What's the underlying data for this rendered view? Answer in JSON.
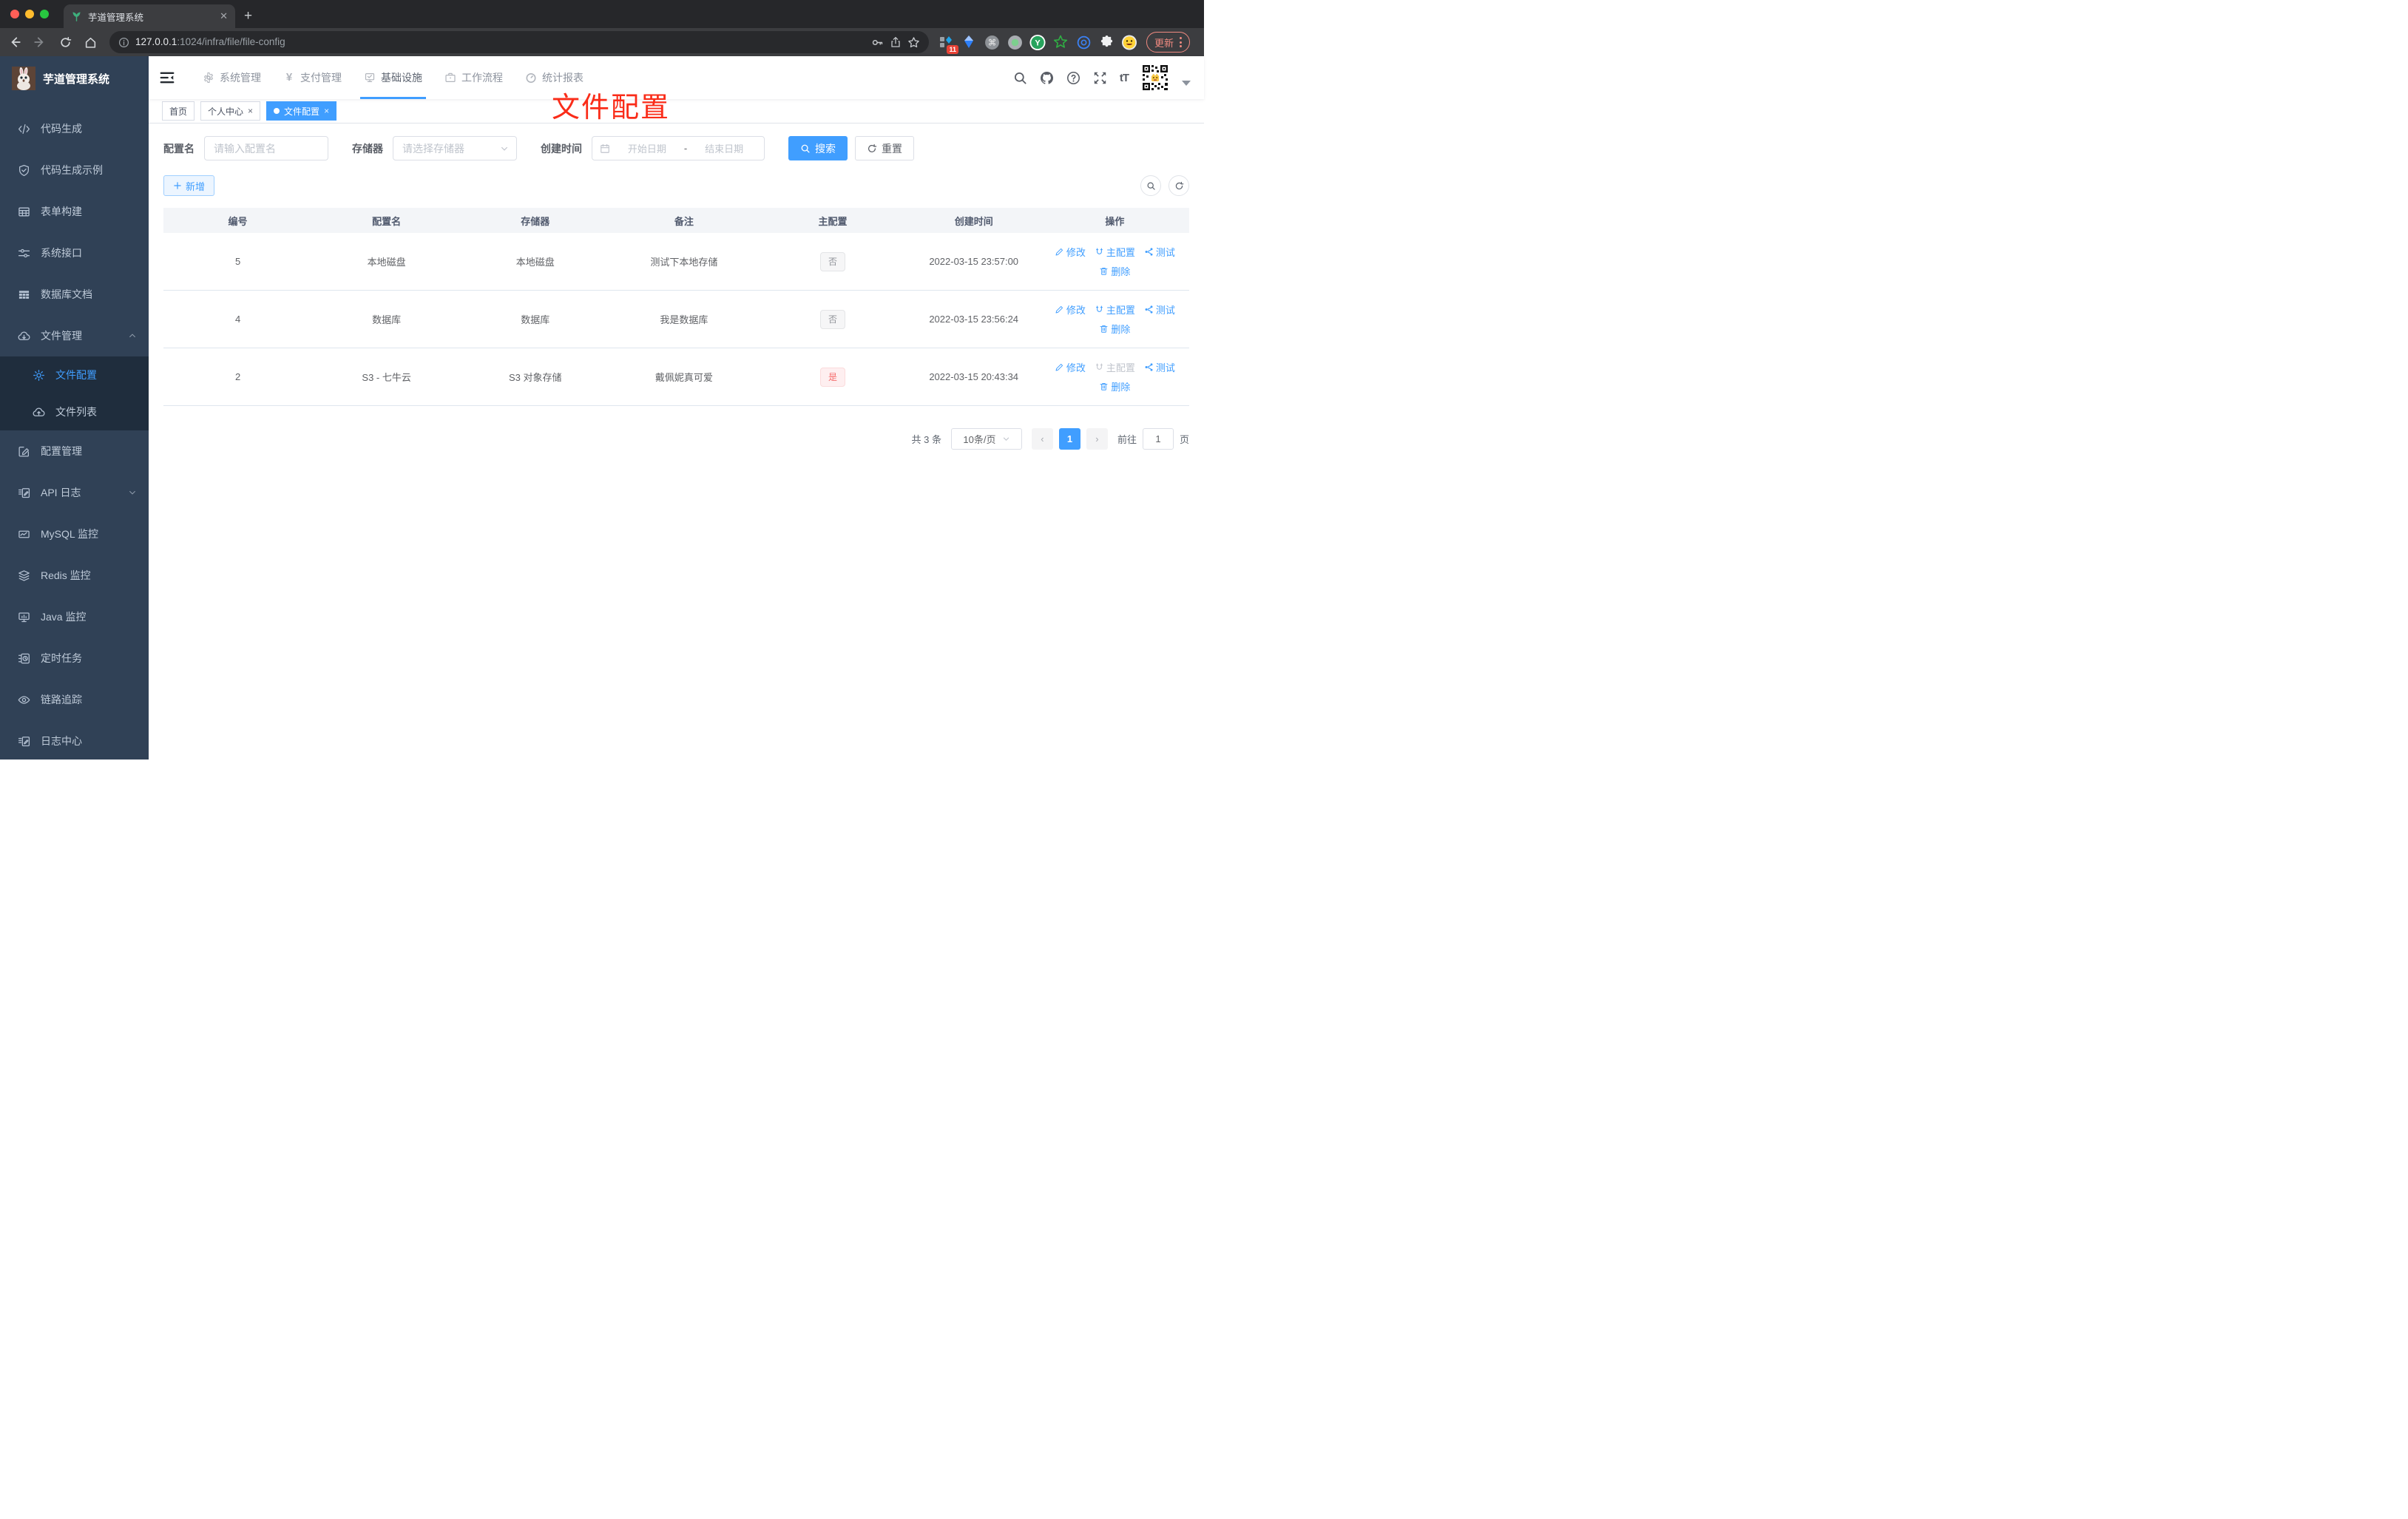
{
  "browser": {
    "tab_title": "芋道管理系统",
    "url_host": "127.0.0.1",
    "url_path": ":1024/infra/file/file-config",
    "extension_badge": "11",
    "update_label": "更新"
  },
  "header": {
    "nav": [
      {
        "label": "系统管理",
        "icon": "gear-icon"
      },
      {
        "label": "支付管理",
        "icon": "yen-icon"
      },
      {
        "label": "基础设施",
        "icon": "infra-monitor-icon",
        "active": true
      },
      {
        "label": "工作流程",
        "icon": "briefcase-icon"
      },
      {
        "label": "统计报表",
        "icon": "dashboard-icon"
      }
    ],
    "font_size_label": "tT",
    "right_icons": [
      "search-icon",
      "github-icon",
      "question-icon",
      "fullscreen-icon",
      "font-size-icon",
      "qr-avatar",
      "chevron-down-icon"
    ]
  },
  "sidebar": {
    "logo_title": "芋道管理系统",
    "items": [
      {
        "label": "代码生成",
        "icon": "code-icon"
      },
      {
        "label": "代码生成示例",
        "icon": "shield-check-icon"
      },
      {
        "label": "表单构建",
        "icon": "form-grid-icon"
      },
      {
        "label": "系统接口",
        "icon": "sliders-icon"
      },
      {
        "label": "数据库文档",
        "icon": "table-solid-icon"
      },
      {
        "label": "文件管理",
        "icon": "cloud-download-icon",
        "expanded": true
      },
      {
        "label": "文件配置",
        "icon": "gear-icon",
        "child": true,
        "active": true
      },
      {
        "label": "文件列表",
        "icon": "cloud-upload-icon",
        "child": true
      },
      {
        "label": "配置管理",
        "icon": "edit-square-icon"
      },
      {
        "label": "API 日志",
        "icon": "log-doc-icon",
        "collapsed": true
      },
      {
        "label": "MySQL 监控",
        "icon": "chart-box-icon"
      },
      {
        "label": "Redis 监控",
        "icon": "layers-icon"
      },
      {
        "label": "Java 监控",
        "icon": "monitor-icon"
      },
      {
        "label": "定时任务",
        "icon": "timer-icon"
      },
      {
        "label": "链路追踪",
        "icon": "eye-icon"
      },
      {
        "label": "日志中心",
        "icon": "log-doc-icon"
      }
    ]
  },
  "tags": {
    "items": [
      {
        "label": "首页",
        "closable": false,
        "active": false
      },
      {
        "label": "个人中心",
        "closable": true,
        "active": false
      },
      {
        "label": "文件配置",
        "closable": true,
        "active": true
      }
    ]
  },
  "annotation": {
    "text": "文件配置",
    "color": "#fa2c19"
  },
  "filters": {
    "name_label": "配置名",
    "name_placeholder": "请输入配置名",
    "storage_label": "存储器",
    "storage_placeholder": "请选择存储器",
    "time_label": "创建时间",
    "start_placeholder": "开始日期",
    "range_separator": "-",
    "end_placeholder": "结束日期",
    "search_label": "搜索",
    "reset_label": "重置"
  },
  "toolbar": {
    "add_label": "新增"
  },
  "table": {
    "headers": [
      "编号",
      "配置名",
      "存储器",
      "备注",
      "主配置",
      "创建时间",
      "操作"
    ],
    "action_labels": {
      "edit": "修改",
      "master": "主配置",
      "test": "测试",
      "delete": "删除"
    },
    "rows": [
      {
        "id": "5",
        "name": "本地磁盘",
        "storage": "本地磁盘",
        "remark": "测试下本地存储",
        "master": "否",
        "master_type": "info",
        "created": "2022-03-15 23:57:00",
        "master_action_disabled": false
      },
      {
        "id": "4",
        "name": "数据库",
        "storage": "数据库",
        "remark": "我是数据库",
        "master": "否",
        "master_type": "info",
        "created": "2022-03-15 23:56:24",
        "master_action_disabled": false
      },
      {
        "id": "2",
        "name": "S3 - 七牛云",
        "storage": "S3 对象存储",
        "remark": "戴佩妮真可爱",
        "master": "是",
        "master_type": "danger",
        "created": "2022-03-15 20:43:34",
        "master_action_disabled": true
      }
    ]
  },
  "pagination": {
    "total": "共 3 条",
    "page_size": "10条/页",
    "current_page": "1",
    "goto_label": "前往",
    "goto_value": "1",
    "page_suffix": "页"
  },
  "colors": {
    "primary": "#409eff",
    "danger": "#f56c6c",
    "annotation_red": "#fa2c19",
    "sidebar_bg": "#304156"
  }
}
